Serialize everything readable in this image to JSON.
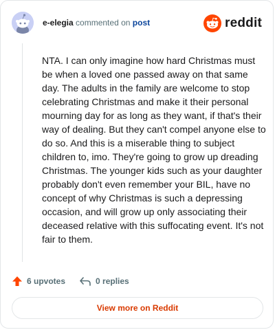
{
  "header": {
    "username": "e-elegia",
    "action_text": "commented on",
    "post_link": "post",
    "avatar_icon": "snoo-avatar-icon",
    "brand_icon": "reddit-logo-icon",
    "brand_word": "reddit"
  },
  "comment": {
    "text": "NTA. I can only imagine how hard Christmas must be when a loved one passed away on that same day. The adults in the family are welcome to stop celebrating Christmas and make it their personal mourning day for as long as they want, if that's their way of dealing. But they can't compel anyone else to do so. And this is a miserable thing to subject children to, imo. They're going to grow up dreading Christmas. The younger kids such as your daughter probably don't even remember your BIL, have no concept of why Christmas is such a depressing occasion, and will grow up only associating their deceased relative with this suffocating event. It's not fair to them."
  },
  "actions": {
    "upvotes_label": "6 upvotes",
    "replies_label": "0 replies",
    "upvote_icon": "upvote-arrow-icon",
    "reply_icon": "reply-arrow-icon"
  },
  "footer": {
    "view_more_label": "View more on Reddit"
  },
  "colors": {
    "brand_orange": "#ff4500",
    "link_blue": "#0a449b",
    "view_more_text": "#d93a00",
    "muted_text": "#576f76"
  }
}
